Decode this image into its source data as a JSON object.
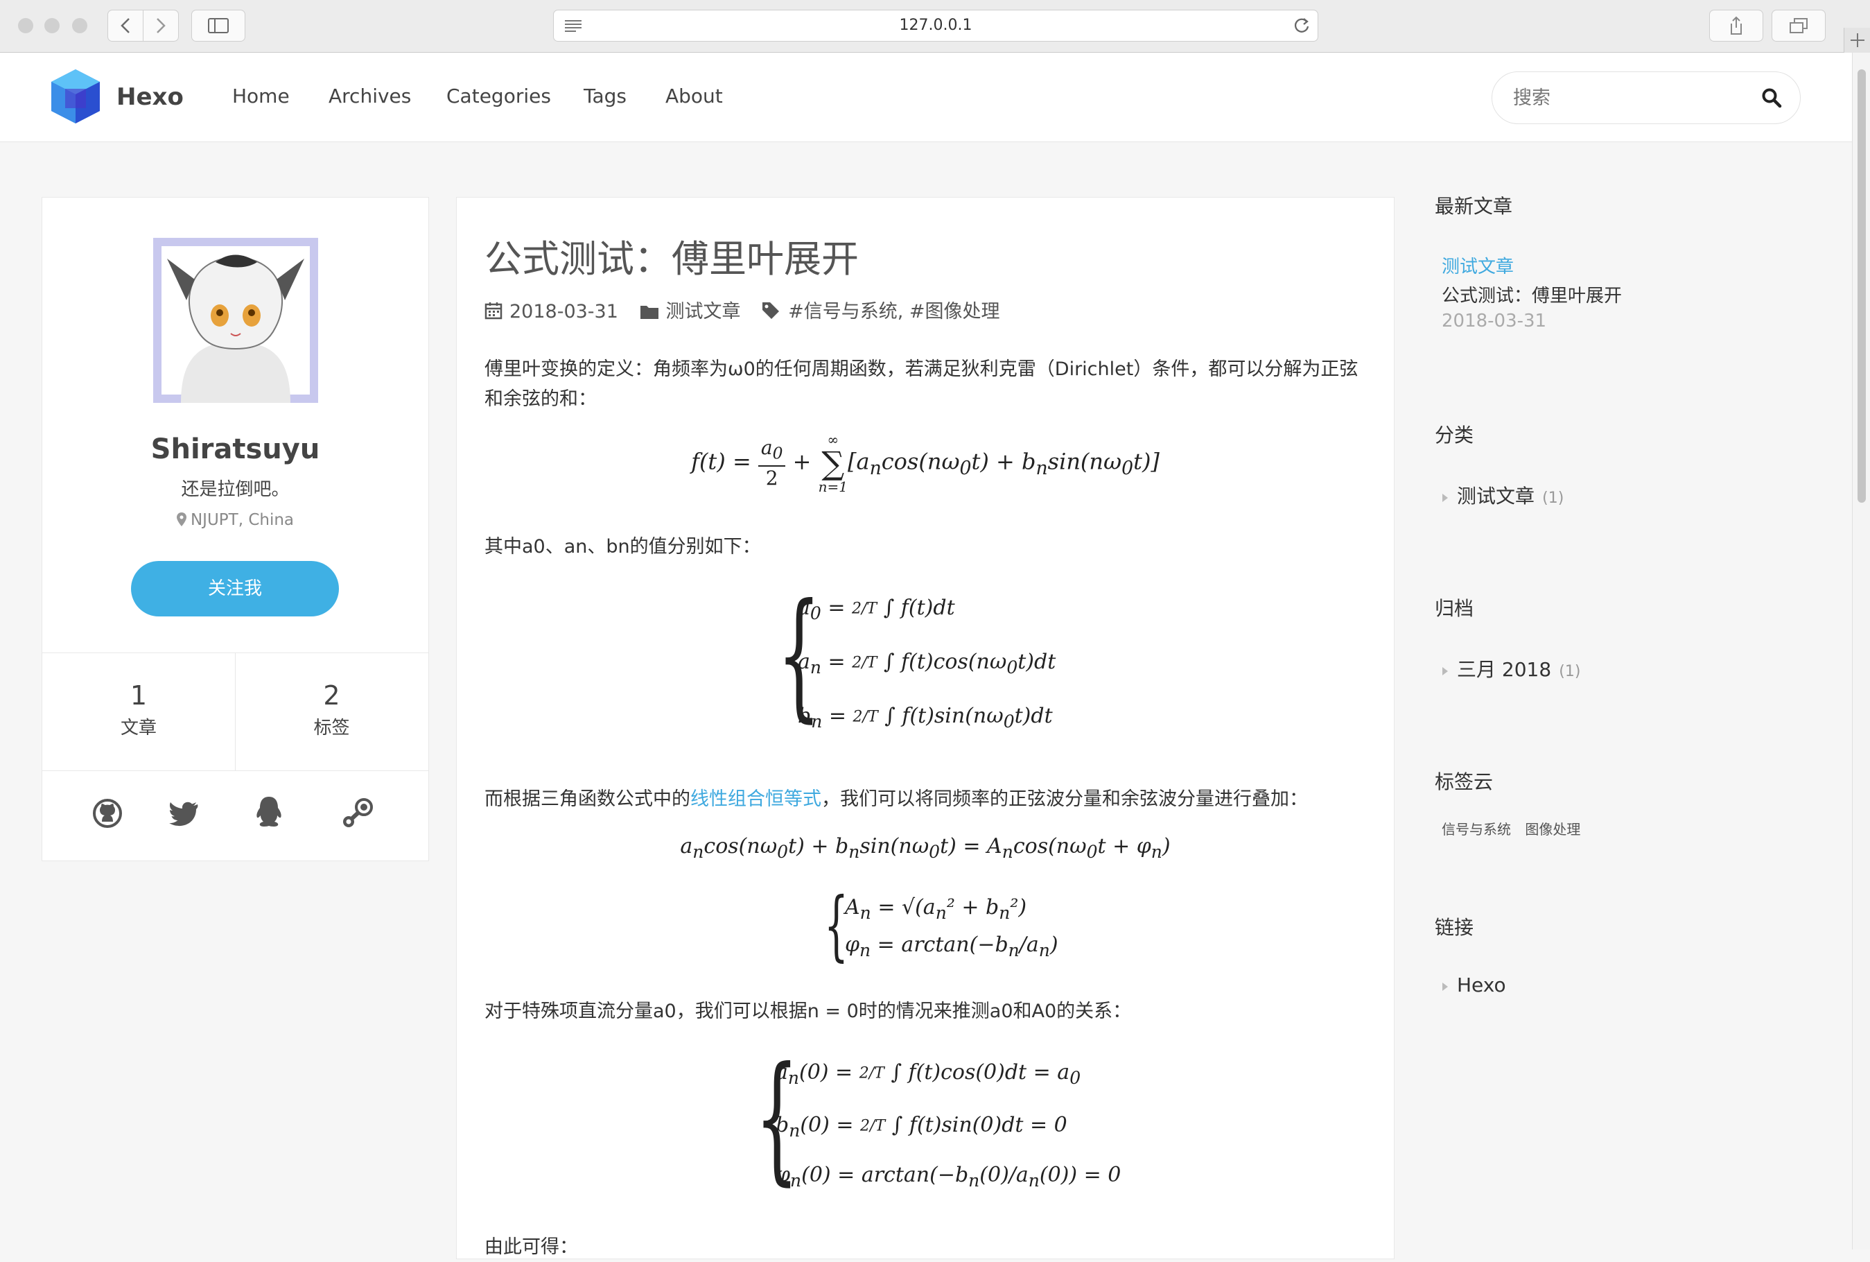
{
  "browser": {
    "url": "127.0.0.1"
  },
  "header": {
    "brand": "Hexo",
    "nav": [
      {
        "label": "Home"
      },
      {
        "label": "Archives"
      },
      {
        "label": "Categories"
      },
      {
        "label": "Tags"
      },
      {
        "label": "About"
      }
    ],
    "search_placeholder": "搜索"
  },
  "profile": {
    "name": "Shiratsuyu",
    "bio": "还是拉倒吧。",
    "location": "NJUPT, China",
    "follow_label": "关注我",
    "stats": [
      {
        "count": "1",
        "label": "文章"
      },
      {
        "count": "2",
        "label": "标签"
      }
    ],
    "social_icons": [
      "github-icon",
      "twitter-icon",
      "qq-icon",
      "steam-icon"
    ]
  },
  "post": {
    "title": "公式测试：傅里叶展开",
    "date": "2018-03-31",
    "category": "测试文章",
    "tags": "#信号与系统, #图像处理",
    "p1": "傅里叶变换的定义：角频率为ω0的任何周期函数，若满足狄利克雷（Dirichlet）条件，都可以分解为正弦和余弦的和：",
    "p2": "其中a0、an、bn的值分别如下：",
    "p3_before": "而根据三角函数公式中的",
    "p3_link": "线性组合恒等式",
    "p3_after": "，我们可以将同频率的正弦波分量和余弦波分量进行叠加：",
    "p4": "对于特殊项直流分量a0，我们可以根据n = 0时的情况来推测a0和A0的关系：",
    "p5": "由此可得："
  },
  "sidebar": {
    "recent_title": "最新文章",
    "recent_category": "测试文章",
    "recent_post": "公式测试：傅里叶展开",
    "recent_date": "2018-03-31",
    "categories_title": "分类",
    "categories": [
      {
        "name": "测试文章",
        "count": "(1)"
      }
    ],
    "archives_title": "归档",
    "archives": [
      {
        "name": "三月 2018",
        "count": "(1)"
      }
    ],
    "tagcloud_title": "标签云",
    "tags": [
      "信号与系统",
      "图像处理"
    ],
    "links_title": "链接",
    "links": [
      "Hexo"
    ]
  },
  "colors": {
    "accent": "#3fb0e4",
    "link": "#3fa9df",
    "muted": "#999999"
  }
}
